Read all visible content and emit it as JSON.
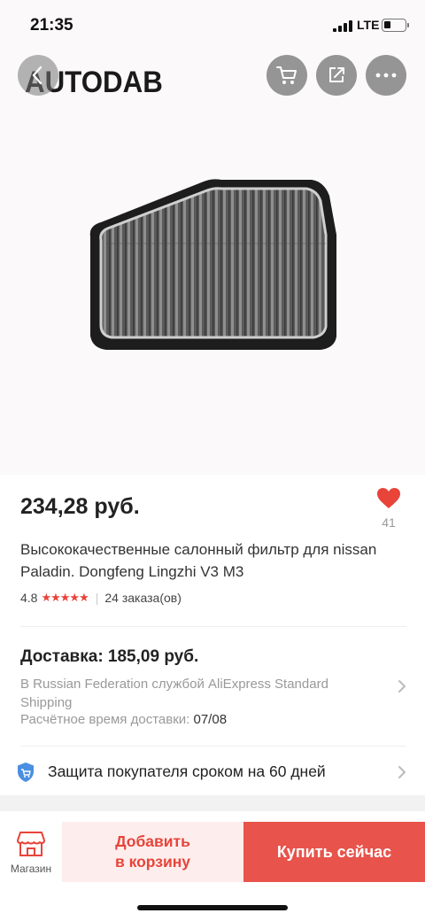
{
  "status_bar": {
    "time": "21:35",
    "network": "LTE"
  },
  "header": {
    "brand_logo": "AUTODAB",
    "icons": [
      "back-arrow-icon",
      "cart-icon",
      "share-icon",
      "more-icon"
    ]
  },
  "product": {
    "price": "234,28 руб.",
    "favorites_count": "41",
    "title": "Высококачественные салонный фильтр для nissan Paladin. Dongfeng Lingzhi V3 M3",
    "rating": "4.8",
    "rating_stars": 5,
    "orders": "24 заказа(ов)"
  },
  "delivery": {
    "title": "Доставка: 185,09 руб.",
    "description": "В Russian Federation службой AliExpress Standard Shipping",
    "time_label": "Расчётное время доставки:",
    "time_value": "07/08"
  },
  "protection": {
    "text": "Защита покупателя сроком на 60 дней"
  },
  "bottom_bar": {
    "store_label": "Магазин",
    "add_to_cart_line1": "Добавить",
    "add_to_cart_line2": "в корзину",
    "buy_now": "Купить сейчас"
  },
  "colors": {
    "accent": "#e8443a",
    "buy_button": "#e8534b",
    "add_cart_bg": "#fdeeed",
    "protect_icon": "#4a8fe0"
  }
}
